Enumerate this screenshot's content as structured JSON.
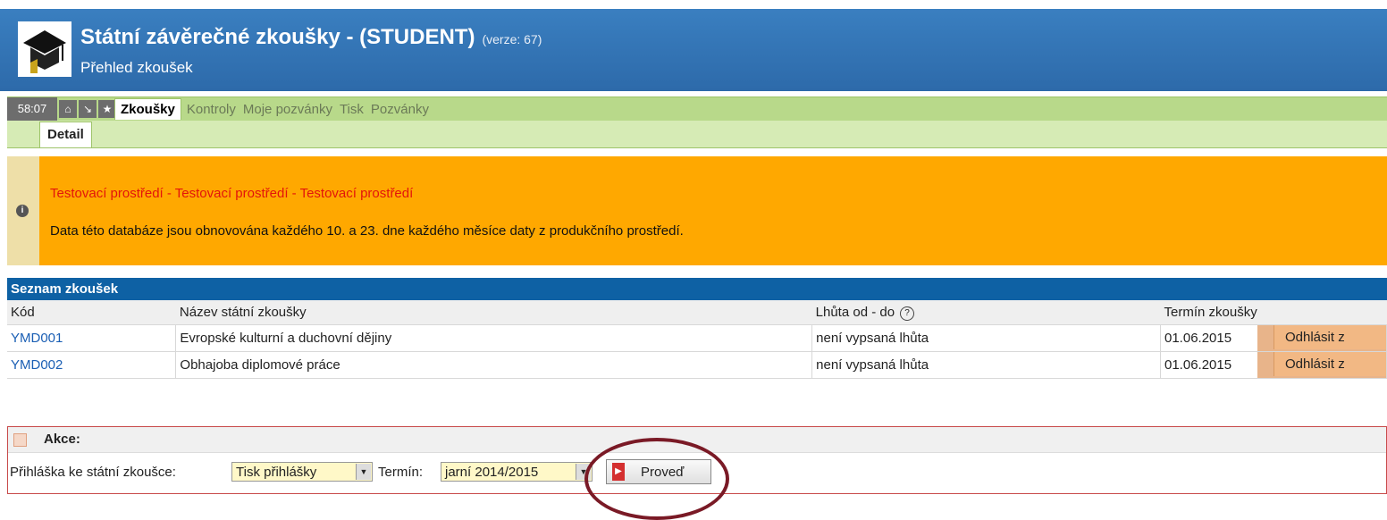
{
  "header": {
    "title": "Státní závěrečné zkoušky - (STUDENT)",
    "version": "(verze: 67)",
    "subtitle": "Přehled zkoušek"
  },
  "nav": {
    "timer": "58:07",
    "icons": [
      "home-icon",
      "exit-icon",
      "star-icon"
    ],
    "tabs": [
      {
        "label": "Zkoušky",
        "active": true
      },
      {
        "label": "Kontroly"
      },
      {
        "label": "Moje pozvánky"
      },
      {
        "label": "Tisk"
      },
      {
        "label": "Pozvánky"
      }
    ],
    "subtab": "Detail"
  },
  "info": {
    "title": "Testovací prostředí - Testovací prostředí - Testovací prostředí",
    "text": "Data této databáze jsou obnovována každého 10. a 23. dne každého měsíce daty z produkčního prostředí."
  },
  "exams": {
    "header": "Seznam zkoušek",
    "columns": [
      "Kód",
      "Název státní zkoušky",
      "Lhůta od - do",
      "Termín zkoušky"
    ],
    "rows": [
      {
        "code": "YMD001",
        "name": "Evropské kulturní a duchovní dějiny",
        "period": "není vypsaná lhůta",
        "date": "01.06.2015",
        "action": "Odhlásit z"
      },
      {
        "code": "YMD002",
        "name": "Obhajoba diplomové práce",
        "period": "není vypsaná lhůta",
        "date": "01.06.2015",
        "action": "Odhlásit z"
      }
    ]
  },
  "actions": {
    "title": "Akce:",
    "application_label": "Přihláška ke státní zkoušce:",
    "application_value": "Tisk přihlášky",
    "term_label": "Termín:",
    "term_value": "jarní 2014/2015",
    "submit": "Proveď"
  },
  "colors": {
    "header_bg": "#2d6aaa",
    "nav_bg": "#b8d98a",
    "info_bg": "#ffa800",
    "info_title": "#e3140b",
    "list_header_bg": "#0e61a4",
    "link": "#1b5fb4",
    "highlight_ellipse": "#7a1a26"
  }
}
